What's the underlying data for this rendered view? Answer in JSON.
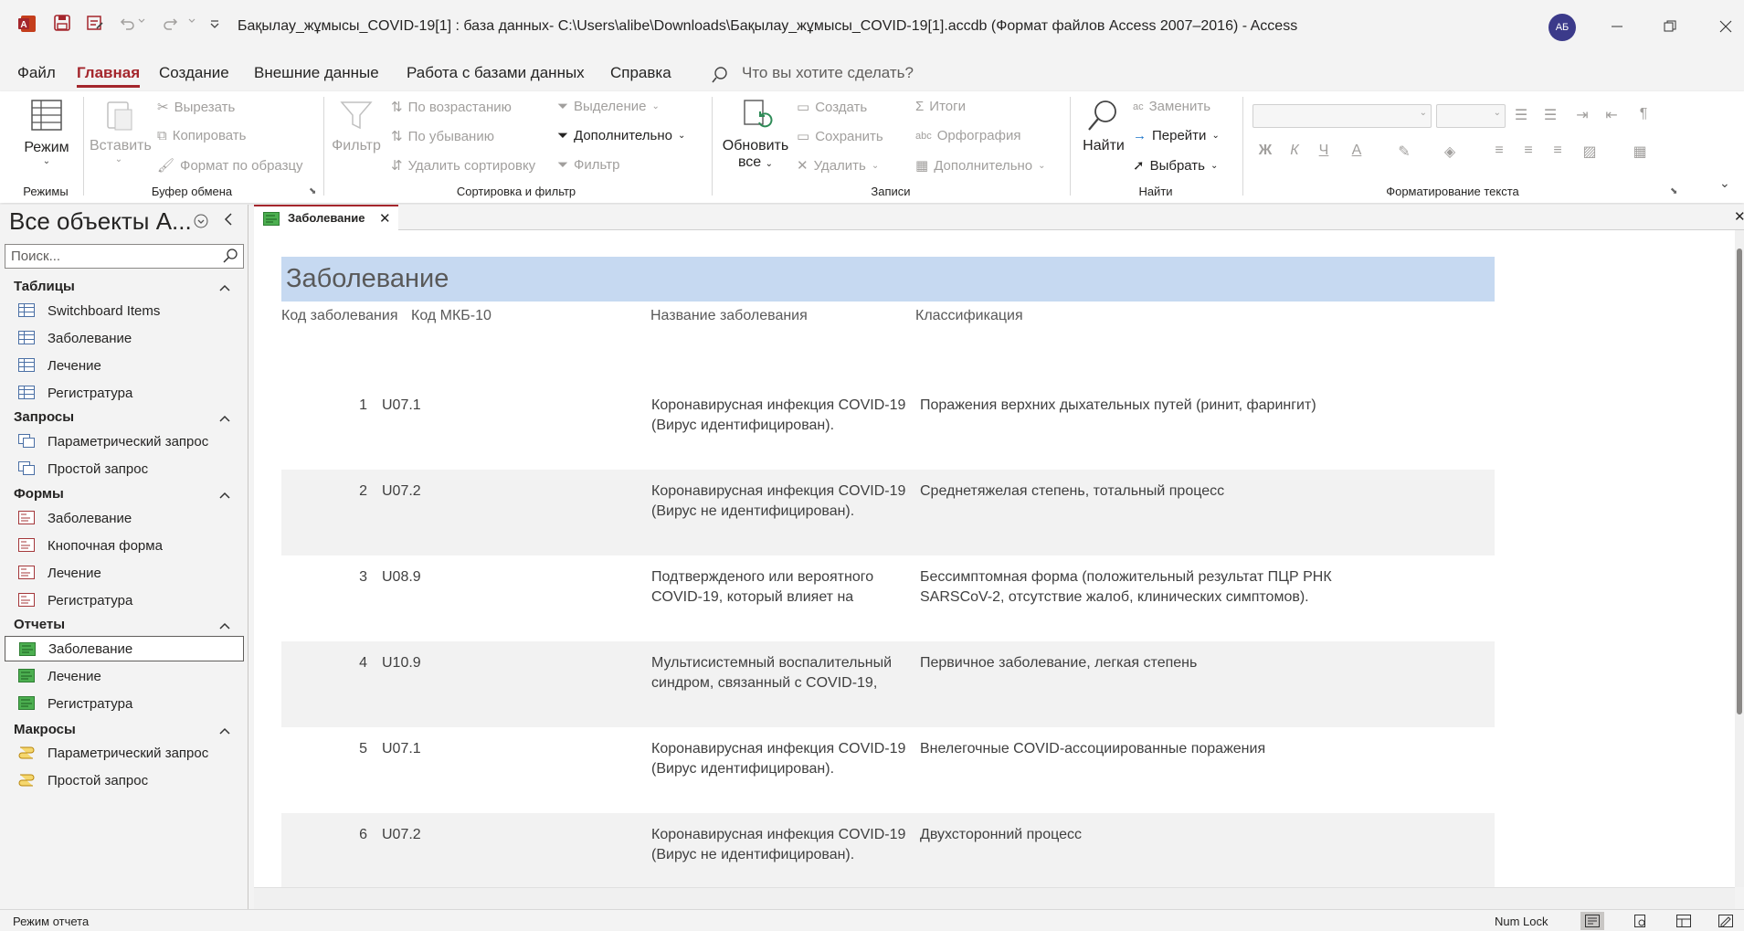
{
  "titlebar": {
    "title": "Бақылау_жұмысы_COVID-19[1] : база данных- C:\\Users\\alibe\\Downloads\\Бақылау_жұмысы_COVID-19[1].accdb (Формат файлов Access 2007–2016)  -  Access",
    "avatar_initials": "АБ"
  },
  "menu": {
    "items": [
      "Файл",
      "Главная",
      "Создание",
      "Внешние данные",
      "Работа с базами данных",
      "Справка"
    ],
    "active": "Главная",
    "tell_me": "Что вы хотите сделать?"
  },
  "ribbon": {
    "views": {
      "mode": "Режим",
      "group": "Режимы"
    },
    "clipboard": {
      "paste": "Вставить",
      "cut": "Вырезать",
      "copy": "Копировать",
      "format_painter": "Формат по образцу",
      "group": "Буфер обмена"
    },
    "sort_filter": {
      "filter": "Фильтр",
      "asc": "По возрастанию",
      "desc": "По убыванию",
      "remove_sort": "Удалить сортировку",
      "selection": "Выделение",
      "advanced": "Дополнительно",
      "toggle_filter": "Фильтр",
      "group": "Сортировка и фильтр"
    },
    "records": {
      "refresh_line1": "Обновить",
      "refresh_line2": "все",
      "new": "Создать",
      "save": "Сохранить",
      "delete": "Удалить",
      "totals": "Итоги",
      "spelling": "Орфография",
      "more": "Дополнительно",
      "group": "Записи"
    },
    "find": {
      "find": "Найти",
      "replace": "Заменить",
      "goto": "Перейти",
      "select": "Выбрать",
      "group": "Найти"
    },
    "text_format": {
      "bold": "Ж",
      "italic": "К",
      "underline": "Ч",
      "font_color": "А",
      "group": "Форматирование текста"
    }
  },
  "nav": {
    "title": "Все объекты А...",
    "search_placeholder": "Поиск...",
    "groups": [
      {
        "label": "Таблицы",
        "items": [
          "Switchboard Items",
          "Заболевание",
          "Лечение",
          "Регистратура"
        ]
      },
      {
        "label": "Запросы",
        "items": [
          "Параметрический запрос",
          "Простой запрос"
        ]
      },
      {
        "label": "Формы",
        "items": [
          "Заболевание",
          "Кнопочная форма",
          "Лечение",
          "Регистратура"
        ]
      },
      {
        "label": "Отчеты",
        "items": [
          "Заболевание",
          "Лечение",
          "Регистратура"
        ]
      },
      {
        "label": "Макросы",
        "items": [
          "Параметрический запрос",
          "Простой запрос"
        ]
      }
    ],
    "selected": "Отчеты/Заболевание"
  },
  "document": {
    "tab_label": "Заболевание",
    "report_title": "Заболевание",
    "columns": [
      "Код заболевания",
      "Код МКБ-10",
      "Название заболевания",
      "Классификация"
    ],
    "rows": [
      {
        "id": "1",
        "code": "U07.1",
        "name": "Коронавирусная инфекция COVID-19  (Вирус идентифицирован).",
        "class": "Поражения верхних дыхательных путей (ринит, фарингит)"
      },
      {
        "id": "2",
        "code": "U07.2",
        "name": "Коронавирусная инфекция COVID-19 (Вирус не идентифицирован).",
        "class": "Среднетяжелая степень, тотальный процесс"
      },
      {
        "id": "3",
        "code": "U08.9",
        "name": "Подтвержденого или вероятного COVID-19, который влияет на",
        "class": "Бессимптомная форма (положительный результат ПЦР РНК SARSCoV-2, отсутствие жалоб, клинических симптомов)."
      },
      {
        "id": "4",
        "code": "U10.9",
        "name": "Мультисистемный воспалительный синдром, связанный с COVID-19,",
        "class": "Первичное заболевание, легкая степень"
      },
      {
        "id": "5",
        "code": "U07.1",
        "name": "Коронавирусная инфекция COVID-19  (Вирус идентифицирован).",
        "class": "Внелегочные COVID-ассоциированные поражения"
      },
      {
        "id": "6",
        "code": "U07.2",
        "name": "Коронавирусная инфекция COVID-19 (Вирус не идентифицирован).",
        "class": "Двухсторонний процесс"
      }
    ]
  },
  "status": {
    "mode": "Режим отчета",
    "numlock": "Num Lock"
  }
}
